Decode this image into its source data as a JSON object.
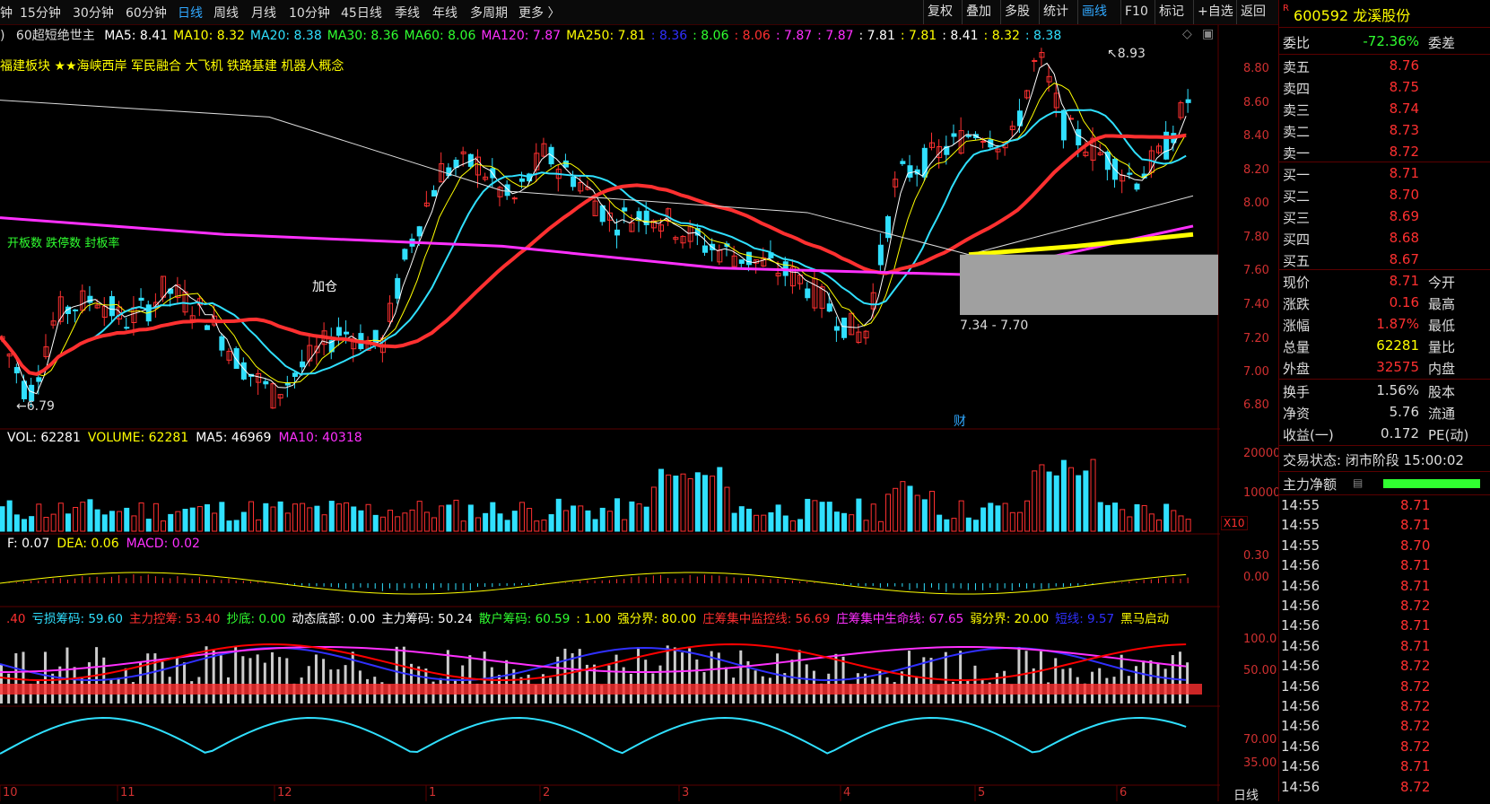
{
  "toolbar": {
    "left_items": [
      "钟",
      "15分钟",
      "30分钟",
      "60分钟",
      "日线",
      "周线",
      "月线",
      "10分钟",
      "45日线",
      "季线",
      "年线",
      "多周期",
      "更多 〉"
    ],
    "active_left": "日线",
    "right_items": [
      "复权",
      "叠加",
      "多股",
      "统计",
      "画线",
      "F10",
      "标记",
      "+自选",
      "返回"
    ],
    "active_right": "画线"
  },
  "stock": {
    "prefix": "R",
    "code": "600592",
    "name": "龙溪股份"
  },
  "main_legend": {
    "indicator": "60超短绝世主",
    "items": [
      {
        "text": "MA5: 8.41",
        "color": "#ffffff"
      },
      {
        "text": "MA10: 8.32",
        "color": "#ffff00"
      },
      {
        "text": "MA20: 8.38",
        "color": "#30e0ff"
      },
      {
        "text": "MA30: 8.36",
        "color": "#30ff30"
      },
      {
        "text": "MA60: 8.06",
        "color": "#30ff30"
      },
      {
        "text": "MA120: 7.87",
        "color": "#ff30ff"
      },
      {
        "text": "MA250: 7.81",
        "color": "#ffff00"
      },
      {
        "text": ": 8.36",
        "color": "#3030ff"
      },
      {
        "text": ": 8.06",
        "color": "#30ff30"
      },
      {
        "text": ": 8.06",
        "color": "#ff3030"
      },
      {
        "text": ": 7.87",
        "color": "#ff30ff"
      },
      {
        "text": ": 7.87",
        "color": "#ff30ff"
      },
      {
        "text": ": 7.81",
        "color": "#ffffff"
      },
      {
        "text": ": 7.81",
        "color": "#ffff00"
      },
      {
        "text": ": 8.41",
        "color": "#ffffff"
      },
      {
        "text": ": 8.32",
        "color": "#ffff00"
      },
      {
        "text": ": 8.38",
        "color": "#30e0ff"
      }
    ]
  },
  "concepts": "福建板块 ★★海峡西岸 军民融合 大飞机 铁路基建 机器人概念",
  "annotations": {
    "high": "8.93",
    "low": "6.79",
    "range": "7.34 - 7.70",
    "cai": "财",
    "jiacang": "加仓",
    "left_labels": [
      "开板数",
      "跌停数",
      "封板率"
    ]
  },
  "price_axis": [
    "8.80",
    "8.60",
    "8.40",
    "8.20",
    "8.00",
    "7.80",
    "7.60",
    "7.40",
    "7.20",
    "7.00",
    "6.80"
  ],
  "vol_legend": [
    {
      "text": "VOL: 62281",
      "color": "#ffffff"
    },
    {
      "text": "VOLUME: 62281",
      "color": "#ffff00"
    },
    {
      "text": "MA5: 46969",
      "color": "#ffffff"
    },
    {
      "text": "MA10: 40318",
      "color": "#ff30ff"
    }
  ],
  "vol_axis": [
    "20000",
    "10000"
  ],
  "vol_unit": "X10",
  "macd_legend": [
    {
      "text": "F: 0.07",
      "color": "#ffffff"
    },
    {
      "text": "DEA: 0.06",
      "color": "#ffff00"
    },
    {
      "text": "MACD: 0.02",
      "color": "#ff30ff"
    }
  ],
  "macd_axis": [
    "0.30",
    "0.00"
  ],
  "chip_legend": [
    {
      "text": ".40",
      "color": "#ff3030"
    },
    {
      "text": "亏损筹码: 59.60",
      "color": "#30e0ff"
    },
    {
      "text": "主力控筹: 53.40",
      "color": "#ff3030"
    },
    {
      "text": "抄底: 0.00",
      "color": "#30ff30"
    },
    {
      "text": "动态底部: 0.00",
      "color": "#ffffff"
    },
    {
      "text": "主力筹码: 50.24",
      "color": "#ffffff"
    },
    {
      "text": "散户筹码: 60.59",
      "color": "#30ff30"
    },
    {
      "text": ": 1.00",
      "color": "#ffff00"
    },
    {
      "text": "强分界: 80.00",
      "color": "#ffff00"
    },
    {
      "text": "庄筹集中监控线: 56.69",
      "color": "#ff3030"
    },
    {
      "text": "庄筹集中生命线: 67.65",
      "color": "#ff30ff"
    },
    {
      "text": "弱分界: 20.00",
      "color": "#ffff00"
    },
    {
      "text": "短线: 9.57",
      "color": "#3030ff"
    },
    {
      "text": "黑马启动",
      "color": "#ffff00"
    }
  ],
  "chip_axis": [
    "100.0",
    "50.00"
  ],
  "kdj_axis": [
    "70.00",
    "35.00"
  ],
  "date_axis": [
    "10",
    "11",
    "12",
    "1",
    "2",
    "3",
    "4",
    "5",
    "6"
  ],
  "period_label": "日线",
  "colors": {
    "up": "#ff3030",
    "down": "#30e0ff",
    "grid": "#5a0000",
    "accent": "#30a8ff"
  },
  "panel": {
    "weibi": {
      "label": "委比",
      "value": "-72.36%",
      "label2": "委差"
    },
    "asks": [
      {
        "label": "卖五",
        "price": "8.76"
      },
      {
        "label": "卖四",
        "price": "8.75"
      },
      {
        "label": "卖三",
        "price": "8.74"
      },
      {
        "label": "卖二",
        "price": "8.73"
      },
      {
        "label": "卖一",
        "price": "8.72"
      }
    ],
    "bids": [
      {
        "label": "买一",
        "price": "8.71"
      },
      {
        "label": "买二",
        "price": "8.70"
      },
      {
        "label": "买三",
        "price": "8.69"
      },
      {
        "label": "买四",
        "price": "8.68"
      },
      {
        "label": "买五",
        "price": "8.67"
      }
    ],
    "stats": [
      {
        "label": "现价",
        "value": "8.71",
        "label2": "今开",
        "color": "#ff3030"
      },
      {
        "label": "涨跌",
        "value": "0.16",
        "label2": "最高",
        "color": "#ff3030"
      },
      {
        "label": "涨幅",
        "value": "1.87%",
        "label2": "最低",
        "color": "#ff3030"
      },
      {
        "label": "总量",
        "value": "62281",
        "label2": "量比",
        "color": "#ffff00"
      },
      {
        "label": "外盘",
        "value": "32575",
        "label2": "内盘",
        "color": "#ff3030"
      }
    ],
    "stats2": [
      {
        "label": "换手",
        "value": "1.56%",
        "label2": "股本",
        "color": "#dddddd"
      },
      {
        "label": "净资",
        "value": "5.76",
        "label2": "流通",
        "color": "#dddddd"
      },
      {
        "label": "收益(一)",
        "value": "0.172",
        "label2": "PE(动)",
        "color": "#dddddd"
      }
    ],
    "trade_status": "交易状态: 闭市阶段 15:00:02",
    "main_flow": "主力净额",
    "ticks": [
      {
        "t": "14:55",
        "p": "8.71"
      },
      {
        "t": "14:55",
        "p": "8.71"
      },
      {
        "t": "14:55",
        "p": "8.70"
      },
      {
        "t": "14:56",
        "p": "8.71"
      },
      {
        "t": "14:56",
        "p": "8.71"
      },
      {
        "t": "14:56",
        "p": "8.72"
      },
      {
        "t": "14:56",
        "p": "8.71"
      },
      {
        "t": "14:56",
        "p": "8.71"
      },
      {
        "t": "14:56",
        "p": "8.72"
      },
      {
        "t": "14:56",
        "p": "8.72"
      },
      {
        "t": "14:56",
        "p": "8.72"
      },
      {
        "t": "14:56",
        "p": "8.72"
      },
      {
        "t": "14:56",
        "p": "8.72"
      },
      {
        "t": "14:56",
        "p": "8.71"
      },
      {
        "t": "14:56",
        "p": "8.72"
      }
    ]
  }
}
